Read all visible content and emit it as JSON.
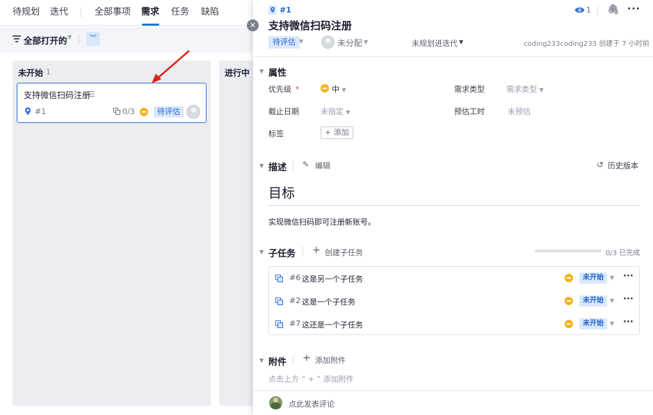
{
  "nav": {
    "tabs": [
      "待规划",
      "迭代",
      "全部事项",
      "需求",
      "任务",
      "缺陷"
    ],
    "active": "需求"
  },
  "filter": {
    "label": "全部打开的"
  },
  "columns": [
    {
      "title": "未开始",
      "count": "1"
    },
    {
      "title": "进行中"
    }
  ],
  "card": {
    "title": "支持微信扫码注册",
    "id": "#1",
    "subtasks": "0/3",
    "status": "待评估"
  },
  "detail": {
    "id": "#1",
    "watchers": "1",
    "title": "支持微信扫码注册",
    "status": "待评估",
    "assignee": "未分配",
    "iteration": "未规划进迭代",
    "creator": "coding233coding233 创建于 7 小时前",
    "properties": {
      "section_title": "属性",
      "priority_label": "优先级",
      "priority_required": "*",
      "priority_value": "中",
      "type_label": "需求类型",
      "type_value": "需求类型",
      "due_label": "截止日期",
      "due_value": "未指定",
      "estimate_label": "预估工时",
      "estimate_value": "未预估",
      "tags_label": "标签",
      "tags_add": "+ 添加"
    },
    "description": {
      "section_title": "描述",
      "edit_label": "编辑",
      "history_label": "历史版本",
      "heading": "目标",
      "body": "实现微信扫码即可注册新账号。"
    },
    "subtasks": {
      "section_title": "子任务",
      "create_label": "创建子任务",
      "progress_text": "0/3 已完成",
      "progress": 0,
      "items": [
        {
          "id": "#6",
          "title": "这是另一个子任务",
          "status": "未开始"
        },
        {
          "id": "#2",
          "title": "这是一个子任务",
          "status": "未开始"
        },
        {
          "id": "#7",
          "title": "这还是一个子任务",
          "status": "未开始"
        }
      ]
    },
    "attachments": {
      "section_title": "附件",
      "add_label": "添加附件",
      "hint": "点击上方 “ + ” 添加附件"
    },
    "comment_placeholder": "点此发表评论"
  },
  "colors": {
    "accent": "#2f6fd8",
    "status_bg": "#dbe8fc",
    "status_text": "#1f64cc",
    "priority_medium": "#f5b21a",
    "annotation_arrow": "#d9221c"
  }
}
